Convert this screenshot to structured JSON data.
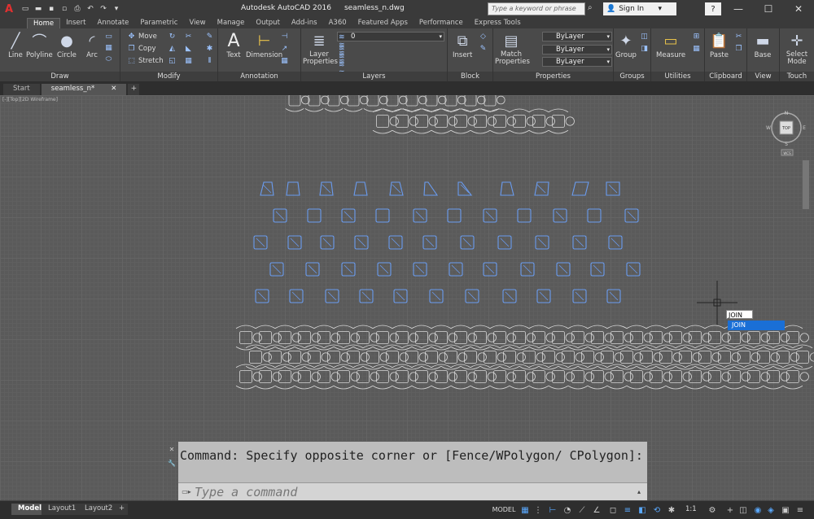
{
  "titlebar": {
    "app_name": "Autodesk AutoCAD 2016",
    "file_name": "seamless_n.dwg",
    "search_placeholder": "Type a keyword or phrase",
    "sign_in": "Sign In"
  },
  "ribbon_tabs": [
    "Home",
    "Insert",
    "Annotate",
    "Parametric",
    "View",
    "Manage",
    "Output",
    "Add-ins",
    "A360",
    "Featured Apps",
    "Performance",
    "Express Tools"
  ],
  "ribbon": {
    "draw": {
      "title": "Draw",
      "line": "Line",
      "polyline": "Polyline",
      "circle": "Circle",
      "arc": "Arc"
    },
    "modify": {
      "title": "Modify",
      "move": "Move",
      "copy": "Copy",
      "stretch": "Stretch"
    },
    "annotation": {
      "title": "Annotation",
      "text": "Text",
      "dimension": "Dimension"
    },
    "layers": {
      "title": "Layers",
      "layer_properties": "Layer Properties",
      "current_layer": "0"
    },
    "block": {
      "title": "Block",
      "insert": "Insert"
    },
    "properties": {
      "title": "Properties",
      "match": "Match Properties",
      "color": "ByLayer",
      "linetype": "ByLayer",
      "lineweight": "ByLayer"
    },
    "groups": {
      "title": "Groups",
      "group": "Group"
    },
    "utilities": {
      "title": "Utilities",
      "measure": "Measure"
    },
    "clipboard": {
      "title": "Clipboard",
      "paste": "Paste"
    },
    "view": {
      "title": "View",
      "base": "Base"
    },
    "touch": {
      "title": "Touch",
      "select_mode": "Select Mode"
    }
  },
  "doc_tabs": {
    "start": "Start",
    "current": "seamless_n*"
  },
  "viewport_label": "[-][Top][2D Wireframe]",
  "viewcube": {
    "face": "TOP",
    "n": "N",
    "s": "S",
    "w": "W",
    "e": "E",
    "wcs": "WCS"
  },
  "autocomplete": {
    "typed": "JOIN",
    "suggestion": "JOIN"
  },
  "command": {
    "history": "Command: Specify opposite corner or [Fence/WPolygon/ CPolygon]:",
    "placeholder": "Type a command"
  },
  "status": {
    "layouts": [
      "Model",
      "Layout1",
      "Layout2"
    ],
    "model_space": "MODEL",
    "scale": "1:1"
  },
  "colors": {
    "selected": "#6a9cf0",
    "unselected": "#d8d8d8",
    "canvas": "#5a5a5a",
    "accent": "#1a6fd6"
  }
}
